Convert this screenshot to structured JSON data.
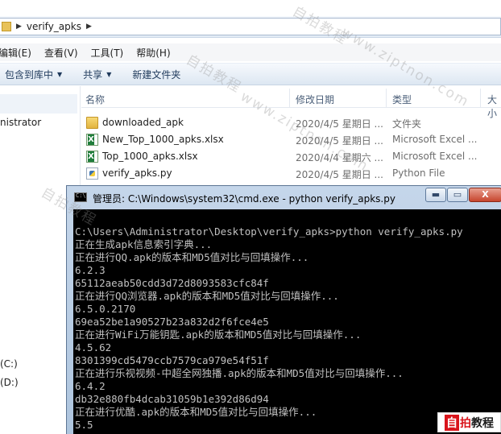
{
  "explorer": {
    "address": {
      "path_text": "verify_apks",
      "separator": "▶"
    },
    "menu": [
      "编辑(E)",
      "查看(V)",
      "工具(T)",
      "帮助(H)"
    ],
    "toolbar": {
      "include_library": "包含到库中",
      "share": "共享",
      "new_folder": "新建文件夹",
      "caret": "▼"
    },
    "nav": {
      "user_label": "nistrator",
      "drive_c": "(C:)",
      "drive_d": "(D:)"
    },
    "columns": {
      "name": "名称",
      "date": "修改日期",
      "type": "类型",
      "size": "大小"
    },
    "files": [
      {
        "name": "downloaded_apk",
        "date": "2020/4/5 星期日 ...",
        "type": "文件夹"
      },
      {
        "name": "New_Top_1000_apks.xlsx",
        "date": "2020/4/5 星期日 ...",
        "type": "Microsoft Excel ..."
      },
      {
        "name": "Top_1000_apks.xlsx",
        "date": "2020/4/4 星期六 ...",
        "type": "Microsoft Excel ..."
      },
      {
        "name": "verify_apks.py",
        "date": "2020/4/5 星期日 ...",
        "type": "Python File"
      }
    ]
  },
  "cmd": {
    "title": "管理员: C:\\Windows\\system32\\cmd.exe - python  verify_apks.py",
    "buttons": {
      "minimize": "▬",
      "maximize": "▭",
      "close": "X"
    },
    "lines": [
      "C:\\Users\\Administrator\\Desktop\\verify_apks>python verify_apks.py",
      "正在生成apk信息索引字典...",
      "正在进行QQ.apk的版本和MD5值对比与回填操作...",
      "6.2.3",
      "65112aeab50cdd3d72d8093583cfc84f",
      "正在进行QQ浏览器.apk的版本和MD5值对比与回填操作...",
      "6.5.0.2170",
      "69ea52be1a90527b23a832d2f6fce4e5",
      "正在进行WiFi万能钥匙.apk的版本和MD5值对比与回填操作...",
      "4.5.62",
      "8301399cd5479ccb7579ca979e54f51f",
      "正在进行乐视视频-中超全网独播.apk的版本和MD5值对比与回填操作...",
      "6.4.2",
      "db32e880fb4dcab31059b1e392d86d94",
      "正在进行优酷.apk的版本和MD5值对比与回填操作...",
      "5.5"
    ]
  },
  "watermarks": [
    "自拍教程",
    "www.ziptnon.com"
  ],
  "logo": {
    "a": "自",
    "b": "拍",
    "c": "教程"
  },
  "colors": {
    "console_bg": "#000000",
    "console_text": "#c0c0c0",
    "titlebar": "#b9cde3",
    "logo_red": "#d9141b"
  }
}
